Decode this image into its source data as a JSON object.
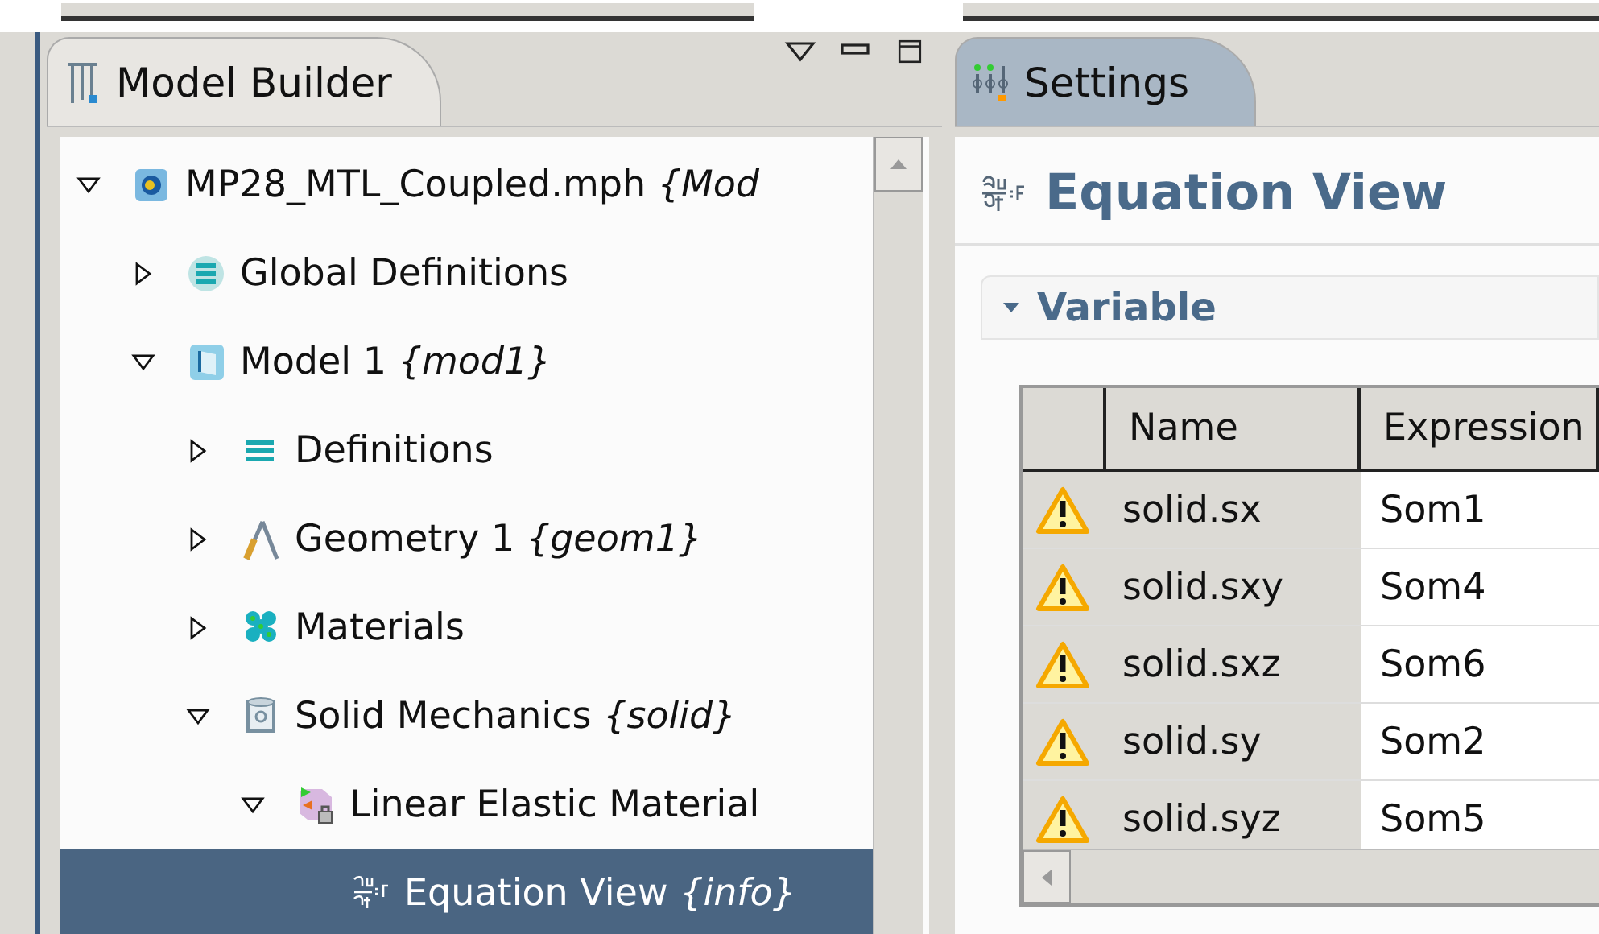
{
  "model_builder": {
    "title": "Model Builder",
    "tree": [
      {
        "label": "MP28_MTL_Coupled.mph *{Mod*",
        "kind": "file",
        "expanded": true,
        "selected": false,
        "children": [
          {
            "label": "Global Definitions",
            "kind": "global",
            "expanded": false,
            "selected": false
          },
          {
            "label": "Model 1 *{mod1}*",
            "kind": "model",
            "expanded": true,
            "selected": false,
            "children": [
              {
                "label": "Definitions",
                "kind": "definitions",
                "expanded": false,
                "selected": false
              },
              {
                "label": "Geometry 1 *{geom1}*",
                "kind": "geometry",
                "expanded": false,
                "selected": false
              },
              {
                "label": "Materials",
                "kind": "materials",
                "expanded": false,
                "selected": false
              },
              {
                "label": "Solid Mechanics *{solid}*",
                "kind": "physics",
                "expanded": true,
                "selected": false,
                "children": [
                  {
                    "label": "Linear Elastic Material",
                    "kind": "material-model",
                    "expanded": true,
                    "selected": false,
                    "children": [
                      {
                        "label": "Equation View *{info}*",
                        "kind": "equation",
                        "selected": true
                      }
                    ]
                  }
                ]
              }
            ]
          }
        ]
      }
    ]
  },
  "settings": {
    "tab": "Settings",
    "title": "Equation View",
    "section": {
      "label": "Variable",
      "expanded": true
    },
    "table": {
      "columns": [
        "Name",
        "Expression"
      ],
      "rows": [
        {
          "warning": true,
          "name": "solid.sx",
          "expression": "Som1"
        },
        {
          "warning": true,
          "name": "solid.sxy",
          "expression": "Som4"
        },
        {
          "warning": true,
          "name": "solid.sxz",
          "expression": "Som6"
        },
        {
          "warning": true,
          "name": "solid.sy",
          "expression": "Som2"
        },
        {
          "warning": true,
          "name": "solid.syz",
          "expression": "Som5"
        }
      ]
    }
  }
}
